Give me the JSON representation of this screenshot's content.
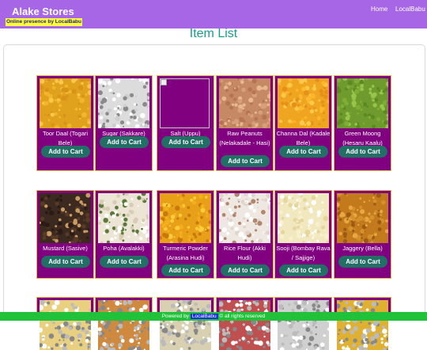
{
  "navbar": {
    "brand": "Alake Stores",
    "tagline": "Online presence by LocalBabu",
    "links": [
      "Home",
      "LocalBabu"
    ]
  },
  "page_title": "Item List",
  "cart_label": "Add to Cart",
  "rows": [
    [
      {
        "name": "Toor Daal (Togari Bele)",
        "image": "toor-daal-photo",
        "color": "#e0a21c"
      },
      {
        "name": "Sugar (Sakkare)",
        "image": "sugar-photo",
        "color": "#dcdcdc"
      },
      {
        "name": "Salt (Uppu)",
        "image": "broken-image",
        "color": "#800080"
      },
      {
        "name": "Raw Peanuts (Nelakadale - Hasi)",
        "image": "peanuts-photo",
        "color": "#c58a64"
      },
      {
        "name": "Channa Dal (Kadale Bele)",
        "image": "channa-dal-photo",
        "color": "#f0a520"
      },
      {
        "name": "Green Moong (Hesaru Kaalu)",
        "image": "green-moong-photo",
        "color": "#6f9a2e"
      }
    ],
    [
      {
        "name": "Mustard (Sasive)",
        "image": "mustard-photo",
        "color": "#3c2a20"
      },
      {
        "name": "Poha (Avalakki)",
        "image": "poha-photo",
        "color": "#ece4d4"
      },
      {
        "name": "Turmeric Powder (Arasina Hudi)",
        "image": "turmeric-photo",
        "color": "#e8a018"
      },
      {
        "name": "Rice Flour (Akki Hudi)",
        "image": "rice-flour-photo",
        "color": "#efe8e2"
      },
      {
        "name": "Sooji (Bombay Rava / Sajjige)",
        "image": "sooji-photo",
        "color": "#f1e8c0"
      },
      {
        "name": "Jaggery (Bella)",
        "image": "jaggery-photo",
        "color": "#c27a1c"
      }
    ],
    [
      {
        "name": "",
        "image": "item-photo",
        "color": "#e8d080"
      },
      {
        "name": "",
        "image": "item-photo",
        "color": "#d08a40"
      },
      {
        "name": "",
        "image": "item-photo",
        "color": "#d8d0b0"
      },
      {
        "name": "",
        "image": "item-photo",
        "color": "#c05050"
      },
      {
        "name": "",
        "image": "item-photo",
        "color": "#d0d0d0"
      },
      {
        "name": "",
        "image": "item-photo",
        "color": "#e0b030"
      }
    ]
  ],
  "footer": {
    "prefix": "Powered by",
    "link": "LocalBabu",
    "suffix": "© all rights reserved"
  }
}
